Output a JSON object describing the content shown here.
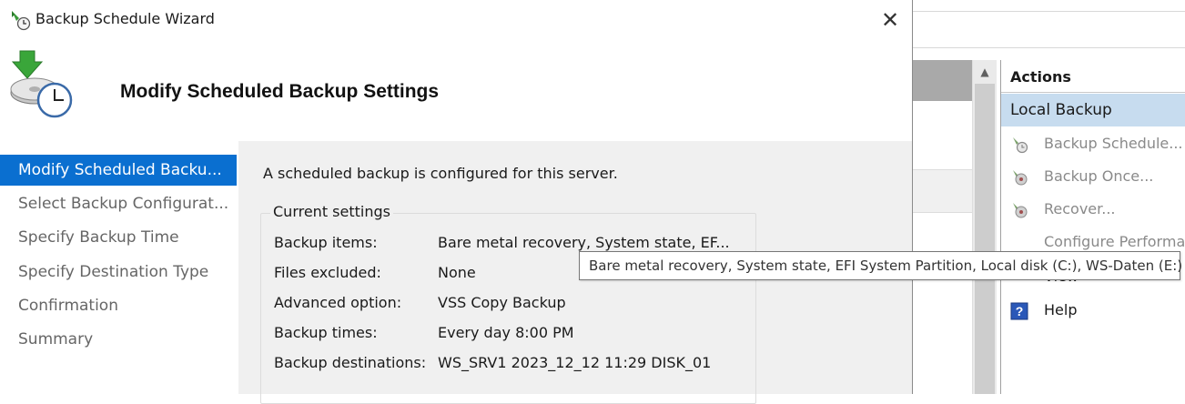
{
  "dialog": {
    "title": "Backup Schedule Wizard",
    "header_title": "Modify Scheduled Backup Settings",
    "close_glyph": "✕"
  },
  "nav": {
    "items": [
      {
        "label": "Modify Scheduled Backu...",
        "active": true
      },
      {
        "label": "Select Backup Configurat..."
      },
      {
        "label": "Specify Backup Time"
      },
      {
        "label": "Specify Destination Type"
      },
      {
        "label": "Confirmation"
      },
      {
        "label": "Summary"
      }
    ]
  },
  "content": {
    "intro": "A scheduled backup is configured for this server.",
    "settings_legend": "Current settings",
    "rows": [
      {
        "label": "Backup items:",
        "value": "Bare metal recovery, System state, EF..."
      },
      {
        "label": "Files excluded:",
        "value": "None"
      },
      {
        "label": "Advanced option:",
        "value": "VSS Copy Backup"
      },
      {
        "label": "Backup times:",
        "value": "Every day 8:00 PM"
      },
      {
        "label": "Backup destinations:",
        "value": "WS_SRV1 2023_12_12 11:29 DISK_01"
      }
    ]
  },
  "tooltip": {
    "text": "Bare metal recovery, System state, EFI System Partition, Local disk (C:), WS-Daten (E:)"
  },
  "actions": {
    "header": "Actions",
    "group": "Local Backup",
    "items": [
      {
        "label": "Backup Schedule...",
        "icon": "backup-schedule-icon",
        "enabled": false
      },
      {
        "label": "Backup Once...",
        "icon": "backup-once-icon",
        "enabled": false
      },
      {
        "label": "Recover...",
        "icon": "recover-icon",
        "enabled": false
      },
      {
        "label": "Configure Performa",
        "icon": "",
        "enabled": false
      },
      {
        "label": "View",
        "icon": "",
        "enabled": true
      },
      {
        "label": "Help",
        "icon": "help-icon",
        "enabled": true
      }
    ]
  },
  "colors": {
    "nav_active": "#0a6fd0",
    "content_bg": "#f0f0f0",
    "actions_group_bg": "#c7dcef",
    "disabled_text": "#8a8a8a"
  }
}
